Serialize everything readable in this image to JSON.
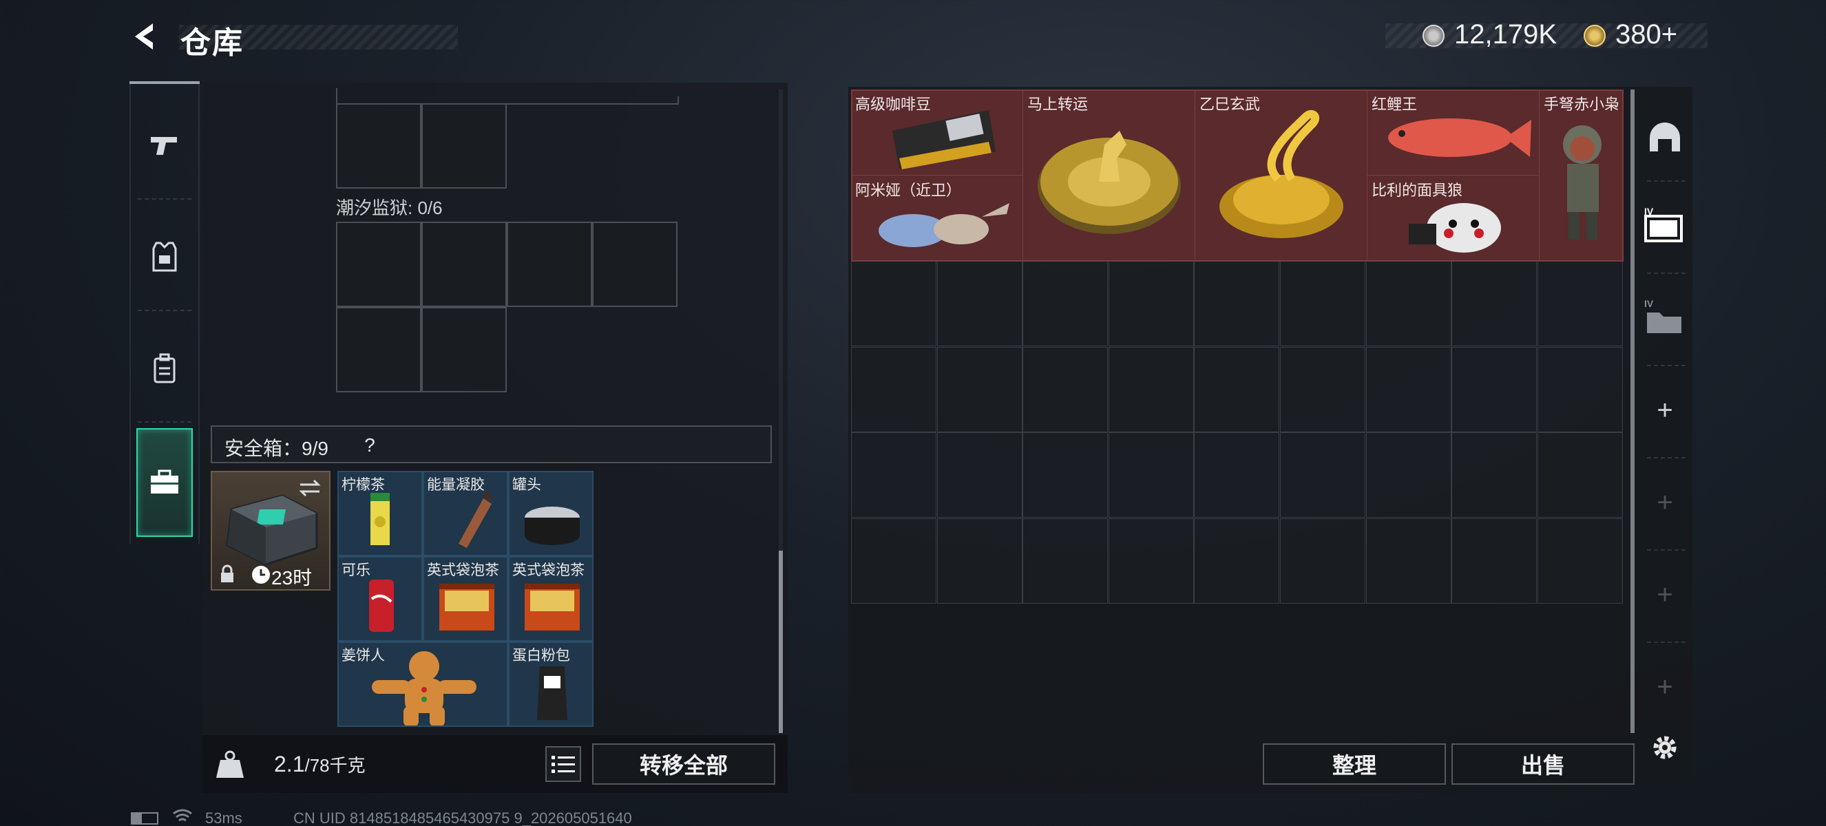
{
  "header": {
    "title": "仓库",
    "currencies": [
      {
        "icon": "silver-coin-icon",
        "value": "12,179K"
      },
      {
        "icon": "gold-coin-icon",
        "value": "380+"
      }
    ]
  },
  "sidebar": {
    "items": [
      {
        "name": "weapon",
        "icon": "gun-icon"
      },
      {
        "name": "armor",
        "icon": "armor-vest-icon"
      },
      {
        "name": "backpack",
        "icon": "backpack-icon"
      },
      {
        "name": "safe-box",
        "icon": "briefcase-icon",
        "active": true
      }
    ]
  },
  "left_panel": {
    "tide_prison_label": "潮汐监狱: 0/6",
    "safe_header": "安全箱：9/9",
    "help_symbol": "?",
    "safe_timer": "23时",
    "safe_items": [
      {
        "name": "柠檬茶",
        "color": "#e8d84a"
      },
      {
        "name": "能量凝胶",
        "color": "#9a5a3a"
      },
      {
        "name": "罐头",
        "color": "#8a8f96"
      },
      {
        "name": "可乐",
        "color": "#c8202a"
      },
      {
        "name": "英式袋泡茶",
        "color": "#c84a1a"
      },
      {
        "name": "英式袋泡茶",
        "color": "#c84a1a"
      },
      {
        "name": "姜饼人",
        "color": "#d48a3a"
      },
      {
        "name": "蛋白粉包",
        "color": "#222222"
      }
    ],
    "weight_current": "2.1",
    "weight_max": "/78千克",
    "transfer_all_label": "转移全部"
  },
  "stash": {
    "items": [
      {
        "name": "高级咖啡豆",
        "color": "#2a2a2a"
      },
      {
        "name": "马上转运",
        "color": "#b8962e"
      },
      {
        "name": "乙巳玄武",
        "color": "#d9a82a"
      },
      {
        "name": "红鲤王",
        "color": "#e0584a"
      },
      {
        "name": "手弩赤小枭",
        "color": "#6a6f60"
      },
      {
        "name": "阿米娅（近卫）",
        "color": "#8aa6d4"
      },
      {
        "name": "比利的面具狼",
        "color": "#e8e8e8"
      }
    ],
    "organize_label": "整理",
    "sell_label": "出售"
  },
  "right_rail": {
    "items": [
      {
        "icon": "helmet-icon"
      },
      {
        "icon": "stash-tab-4-icon",
        "label": "IV"
      },
      {
        "icon": "stash-tab-folder-icon",
        "label": "IV"
      }
    ]
  },
  "status_bar": {
    "ping": "53ms",
    "uid": "CN UID 8148518485465430975 9_202605051640"
  }
}
